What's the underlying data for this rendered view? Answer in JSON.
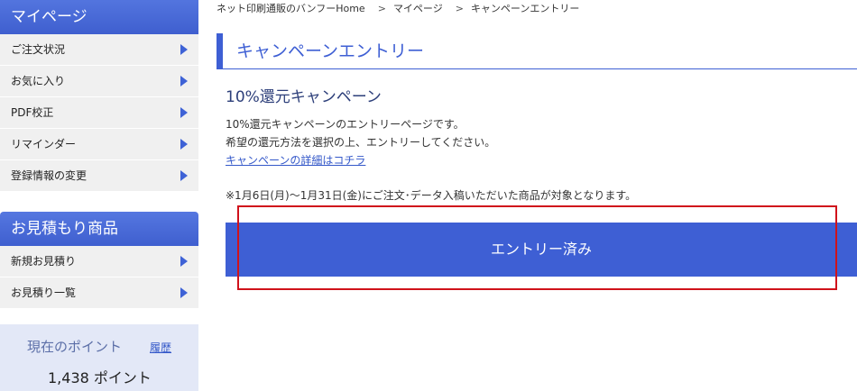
{
  "sidebar": {
    "mypage_title": "マイページ",
    "mypage_items": [
      {
        "label": "ご注文状況"
      },
      {
        "label": "お気に入り"
      },
      {
        "label": "PDF校正"
      },
      {
        "label": "リマインダー"
      },
      {
        "label": "登録情報の変更"
      }
    ],
    "estimate_title": "お見積もり商品",
    "estimate_items": [
      {
        "label": "新規お見積り"
      },
      {
        "label": "お見積り一覧"
      }
    ],
    "points": {
      "label": "現在のポイント",
      "history_link": "履歴",
      "value": "1,438 ポイント"
    }
  },
  "breadcrumb": [
    "ネット印刷通販のバンフーHome",
    "マイページ",
    "キャンペーンエントリー"
  ],
  "breadcrumb_separator": ">",
  "main": {
    "page_title": "キャンペーンエントリー",
    "campaign_title": "10%還元キャンペーン",
    "desc_line1": "10%還元キャンペーンのエントリーページです。",
    "desc_line2": "希望の還元方法を選択の上、エントリーしてください。",
    "detail_link": "キャンペーンの詳細はコチラ",
    "notice": "※1月6日(月)～1月31日(金)にご注文･データ入稿いただいた商品が対象となります。",
    "entry_button": "エントリー済み"
  },
  "colors": {
    "accent": "#3e5fd4",
    "sidebar_bg": "#f0f0f0",
    "points_bg": "#e3e8f7",
    "highlight": "#d0121b"
  }
}
